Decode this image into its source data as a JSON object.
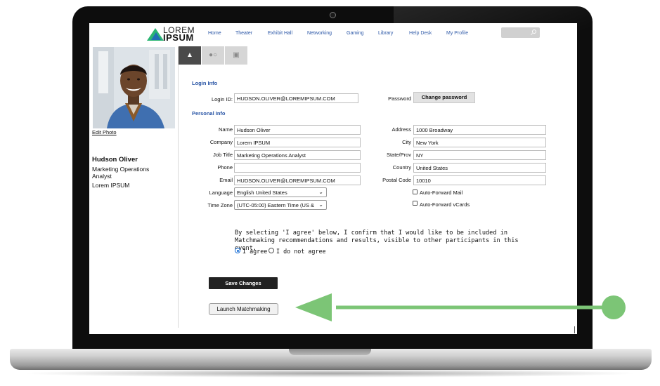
{
  "colors": {
    "accent": "#2a56a6",
    "arrow": "#7cc576",
    "dark_button": "#222222",
    "tab_active": "#4a4a4a"
  },
  "brand": {
    "logo_top": "LOREM",
    "logo_bottom": "IPSUM"
  },
  "nav": [
    {
      "label": "Home"
    },
    {
      "label": "Theater"
    },
    {
      "label": "Exhibit Hall"
    },
    {
      "label": "Networking"
    },
    {
      "label": "Gaming"
    },
    {
      "label": "Library"
    },
    {
      "label": "Help Desk"
    },
    {
      "label": "My Profile"
    }
  ],
  "tabs": [
    {
      "icon": "person-icon",
      "active": true
    },
    {
      "icon": "chat-bubbles-icon",
      "active": false
    },
    {
      "icon": "briefcase-icon",
      "active": false
    }
  ],
  "profile": {
    "edit_photo": "Edit Photo",
    "name": "Hudson Oliver",
    "role": "Marketing Operations Analyst",
    "company": "Lorem IPSUM"
  },
  "login": {
    "section": "Login Info",
    "login_id_label": "Login ID:",
    "login_id_value": "HUDSON.OLIVER@LOREMIPSUM.COM",
    "password_label": "Password",
    "change_password": "Change password"
  },
  "personal": {
    "section": "Personal Info",
    "name_label": "Name",
    "name_value": "Hudson Oliver",
    "company_label": "Company",
    "company_value": "Lorem IPSUM",
    "job_title_label": "Job Title",
    "job_title_value": "Marketing Operations Analyst",
    "phone_label": "Phone",
    "phone_value": "",
    "email_label": "Email",
    "email_value": "HUDSON.OLIVER@LOREMIPSUM.COM",
    "language_label": "Language",
    "language_value": "English United States",
    "timezone_label": "Time Zone",
    "timezone_value": "(UTC-05:00) Eastern Time (US &",
    "address_label": "Address",
    "address_value": "1000 Broadway",
    "city_label": "City",
    "city_value": "New York",
    "state_label": "State/Prov",
    "state_value": "NY",
    "country_label": "Country",
    "country_value": "United States",
    "postal_label": "Postal Code",
    "postal_value": "10010",
    "auto_mail": "Auto-Forward Mail",
    "auto_vcards": "Auto-Forward vCards"
  },
  "consent": {
    "text": "By selecting 'I agree' below, I confirm that I would like to be included in Matchmaking recommendations and results, visible to other participants in this event.",
    "agree": "I agree",
    "disagree": "I do not agree",
    "selected": "agree"
  },
  "actions": {
    "save": "Save Changes",
    "launch": "Launch Matchmaking"
  }
}
